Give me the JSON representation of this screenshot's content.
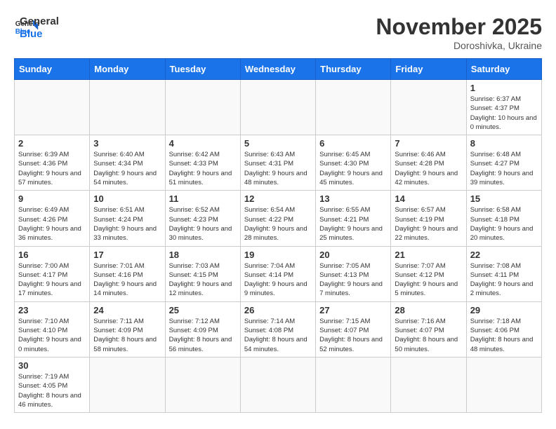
{
  "header": {
    "logo_general": "General",
    "logo_blue": "Blue",
    "month_year": "November 2025",
    "location": "Doroshivka, Ukraine"
  },
  "days_of_week": [
    "Sunday",
    "Monday",
    "Tuesday",
    "Wednesday",
    "Thursday",
    "Friday",
    "Saturday"
  ],
  "weeks": [
    [
      {
        "day": "",
        "info": ""
      },
      {
        "day": "",
        "info": ""
      },
      {
        "day": "",
        "info": ""
      },
      {
        "day": "",
        "info": ""
      },
      {
        "day": "",
        "info": ""
      },
      {
        "day": "",
        "info": ""
      },
      {
        "day": "1",
        "info": "Sunrise: 6:37 AM\nSunset: 4:37 PM\nDaylight: 10 hours and 0 minutes."
      }
    ],
    [
      {
        "day": "2",
        "info": "Sunrise: 6:39 AM\nSunset: 4:36 PM\nDaylight: 9 hours and 57 minutes."
      },
      {
        "day": "3",
        "info": "Sunrise: 6:40 AM\nSunset: 4:34 PM\nDaylight: 9 hours and 54 minutes."
      },
      {
        "day": "4",
        "info": "Sunrise: 6:42 AM\nSunset: 4:33 PM\nDaylight: 9 hours and 51 minutes."
      },
      {
        "day": "5",
        "info": "Sunrise: 6:43 AM\nSunset: 4:31 PM\nDaylight: 9 hours and 48 minutes."
      },
      {
        "day": "6",
        "info": "Sunrise: 6:45 AM\nSunset: 4:30 PM\nDaylight: 9 hours and 45 minutes."
      },
      {
        "day": "7",
        "info": "Sunrise: 6:46 AM\nSunset: 4:28 PM\nDaylight: 9 hours and 42 minutes."
      },
      {
        "day": "8",
        "info": "Sunrise: 6:48 AM\nSunset: 4:27 PM\nDaylight: 9 hours and 39 minutes."
      }
    ],
    [
      {
        "day": "9",
        "info": "Sunrise: 6:49 AM\nSunset: 4:26 PM\nDaylight: 9 hours and 36 minutes."
      },
      {
        "day": "10",
        "info": "Sunrise: 6:51 AM\nSunset: 4:24 PM\nDaylight: 9 hours and 33 minutes."
      },
      {
        "day": "11",
        "info": "Sunrise: 6:52 AM\nSunset: 4:23 PM\nDaylight: 9 hours and 30 minutes."
      },
      {
        "day": "12",
        "info": "Sunrise: 6:54 AM\nSunset: 4:22 PM\nDaylight: 9 hours and 28 minutes."
      },
      {
        "day": "13",
        "info": "Sunrise: 6:55 AM\nSunset: 4:21 PM\nDaylight: 9 hours and 25 minutes."
      },
      {
        "day": "14",
        "info": "Sunrise: 6:57 AM\nSunset: 4:19 PM\nDaylight: 9 hours and 22 minutes."
      },
      {
        "day": "15",
        "info": "Sunrise: 6:58 AM\nSunset: 4:18 PM\nDaylight: 9 hours and 20 minutes."
      }
    ],
    [
      {
        "day": "16",
        "info": "Sunrise: 7:00 AM\nSunset: 4:17 PM\nDaylight: 9 hours and 17 minutes."
      },
      {
        "day": "17",
        "info": "Sunrise: 7:01 AM\nSunset: 4:16 PM\nDaylight: 9 hours and 14 minutes."
      },
      {
        "day": "18",
        "info": "Sunrise: 7:03 AM\nSunset: 4:15 PM\nDaylight: 9 hours and 12 minutes."
      },
      {
        "day": "19",
        "info": "Sunrise: 7:04 AM\nSunset: 4:14 PM\nDaylight: 9 hours and 9 minutes."
      },
      {
        "day": "20",
        "info": "Sunrise: 7:05 AM\nSunset: 4:13 PM\nDaylight: 9 hours and 7 minutes."
      },
      {
        "day": "21",
        "info": "Sunrise: 7:07 AM\nSunset: 4:12 PM\nDaylight: 9 hours and 5 minutes."
      },
      {
        "day": "22",
        "info": "Sunrise: 7:08 AM\nSunset: 4:11 PM\nDaylight: 9 hours and 2 minutes."
      }
    ],
    [
      {
        "day": "23",
        "info": "Sunrise: 7:10 AM\nSunset: 4:10 PM\nDaylight: 9 hours and 0 minutes."
      },
      {
        "day": "24",
        "info": "Sunrise: 7:11 AM\nSunset: 4:09 PM\nDaylight: 8 hours and 58 minutes."
      },
      {
        "day": "25",
        "info": "Sunrise: 7:12 AM\nSunset: 4:09 PM\nDaylight: 8 hours and 56 minutes."
      },
      {
        "day": "26",
        "info": "Sunrise: 7:14 AM\nSunset: 4:08 PM\nDaylight: 8 hours and 54 minutes."
      },
      {
        "day": "27",
        "info": "Sunrise: 7:15 AM\nSunset: 4:07 PM\nDaylight: 8 hours and 52 minutes."
      },
      {
        "day": "28",
        "info": "Sunrise: 7:16 AM\nSunset: 4:07 PM\nDaylight: 8 hours and 50 minutes."
      },
      {
        "day": "29",
        "info": "Sunrise: 7:18 AM\nSunset: 4:06 PM\nDaylight: 8 hours and 48 minutes."
      }
    ],
    [
      {
        "day": "30",
        "info": "Sunrise: 7:19 AM\nSunset: 4:05 PM\nDaylight: 8 hours and 46 minutes."
      },
      {
        "day": "",
        "info": ""
      },
      {
        "day": "",
        "info": ""
      },
      {
        "day": "",
        "info": ""
      },
      {
        "day": "",
        "info": ""
      },
      {
        "day": "",
        "info": ""
      },
      {
        "day": "",
        "info": ""
      }
    ]
  ]
}
